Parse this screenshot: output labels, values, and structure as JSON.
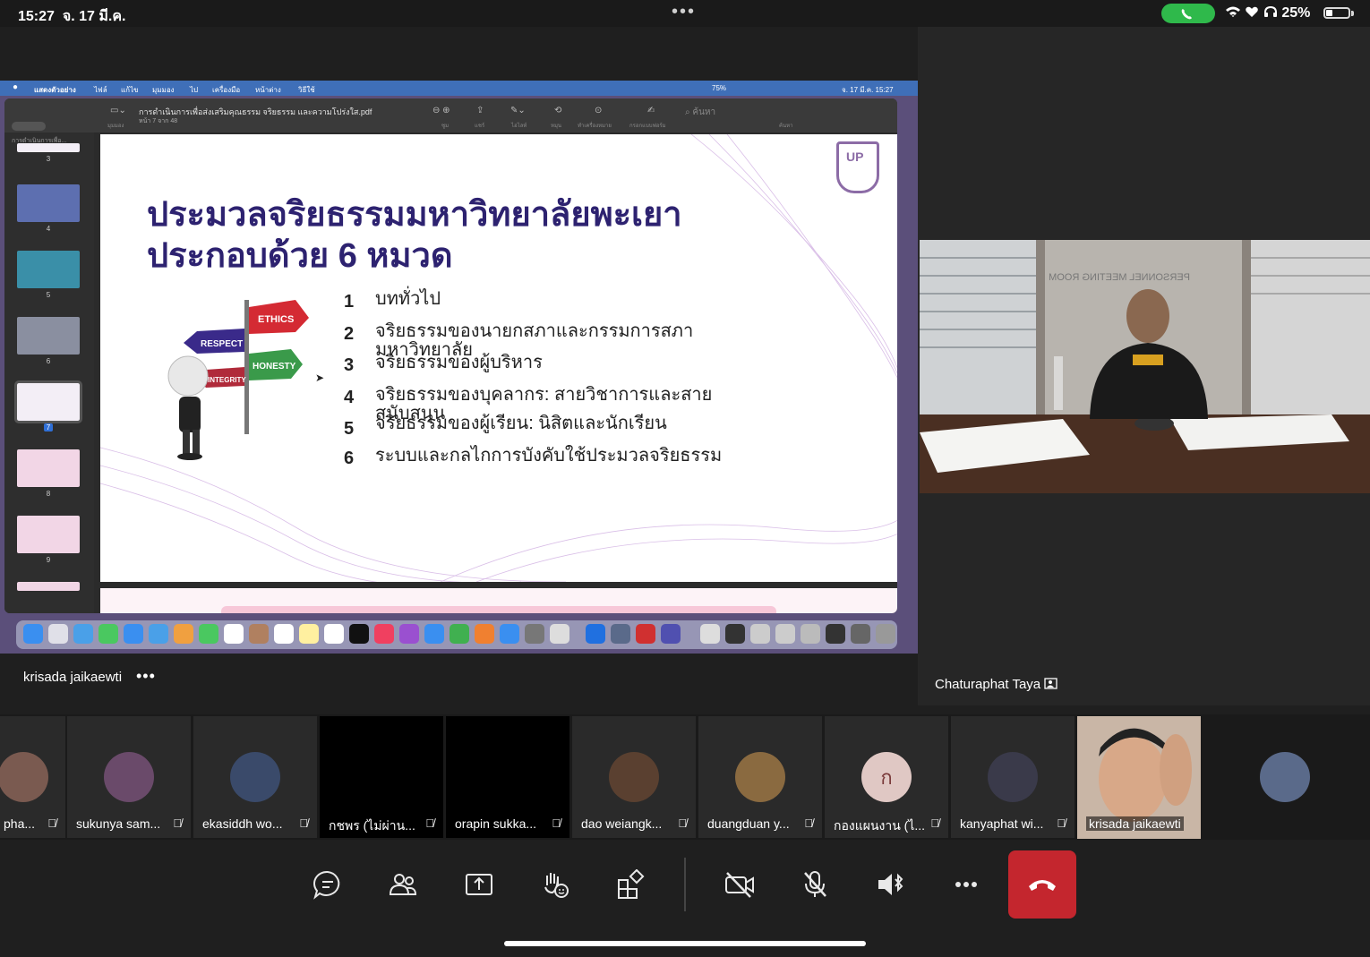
{
  "status_bar": {
    "time": "15:27",
    "date": "จ. 17 มี.ค.",
    "dots": "•••",
    "battery": "25%"
  },
  "shared_screen": {
    "presenter_name": "krisada jaikaewti",
    "more": "•••",
    "mac_menubar": {
      "app": "แสดงตัวอย่าง",
      "items": [
        "ไฟล์",
        "แก้ไข",
        "มุมมอง",
        "ไป",
        "เครื่องมือ",
        "หน้าต่าง",
        "วิธีใช้"
      ],
      "battery": "75%",
      "clock": "จ. 17 มี.ค. 15:27"
    },
    "preview": {
      "file_title": "การดำเนินการเพื่อส่งเสริมคุณธรรม จริยธรรม และความโปร่งใส.pdf",
      "page_info": "หน้า 7 จาก 48",
      "sidebar_header": "การดำเนินการเพื่อ...",
      "toolbar_labels": [
        "มุมมอง",
        "ซูม",
        "แชร์",
        "ไฮไลท์",
        "หมุน",
        "ทำเครื่องหมาย",
        "กรอกแบบฟอร์ม",
        "ค้นหา"
      ],
      "search_placeholder": "ค้นหา",
      "thumbnails": [
        "3",
        "4",
        "5",
        "6",
        "7",
        "8",
        "9"
      ],
      "selected_page": "7"
    },
    "slide": {
      "title_line1": "ประมวลจริยธรรมมหาวิทยาลัยพะเยา",
      "title_line2": "ประกอบด้วย 6 หมวด",
      "logo_text": "UP",
      "sign_labels": [
        "ETHICS",
        "RESPECT",
        "HONESTY",
        "INTEGRITY"
      ],
      "items": [
        {
          "n": "1",
          "text": "บททั่วไป"
        },
        {
          "n": "2",
          "text": "จริยธรรมของนายกสภาและกรรมการสภามหาวิทยาลัย"
        },
        {
          "n": "3",
          "text": "จริยธรรมของผู้บริหาร"
        },
        {
          "n": "4",
          "text": "จริยธรรมของบุคลากร: สายวิชาการและสายสนับสนุน"
        },
        {
          "n": "5",
          "text": "จริยธรรมของผู้เรียน: นิสิตและนักเรียน"
        },
        {
          "n": "6",
          "text": "ระบบและกลไกการบังคับใช้ประมวลจริยธรรม"
        }
      ]
    }
  },
  "video": {
    "name": "Chaturaphat Taya",
    "room_sign": "PERSONNEL MEETING ROOM"
  },
  "participants": [
    {
      "name": "pha...",
      "type": "photo",
      "color": "#7a5a50"
    },
    {
      "name": "sukunya sam...",
      "type": "photo",
      "color": "#6a4a6a"
    },
    {
      "name": "ekasiddh wo...",
      "type": "photo",
      "color": "#3a4a6a"
    },
    {
      "name": "กชพร (ไม่ผ่าน...",
      "type": "dark",
      "color": "#000000"
    },
    {
      "name": "orapin sukka...",
      "type": "dark",
      "color": "#000000"
    },
    {
      "name": "dao weiangk...",
      "type": "photo",
      "color": "#5a4030"
    },
    {
      "name": "duangduan y...",
      "type": "photo",
      "color": "#8a6a40"
    },
    {
      "name": "กองแผนงาน (ไ...",
      "type": "initial",
      "initial": "ก",
      "color": "#e0c8c4"
    },
    {
      "name": "kanyaphat wi...",
      "type": "photo",
      "color": "#3a3a4a"
    },
    {
      "name": "krisada jaikaewti",
      "type": "video",
      "color": "#b8a090"
    },
    {
      "name": "",
      "type": "photo",
      "color": "#5a6a8a"
    }
  ],
  "controls": [
    "chat",
    "people",
    "share",
    "raise-hand",
    "apps",
    "camera-off",
    "mic-off",
    "speaker",
    "more",
    "hang-up"
  ]
}
